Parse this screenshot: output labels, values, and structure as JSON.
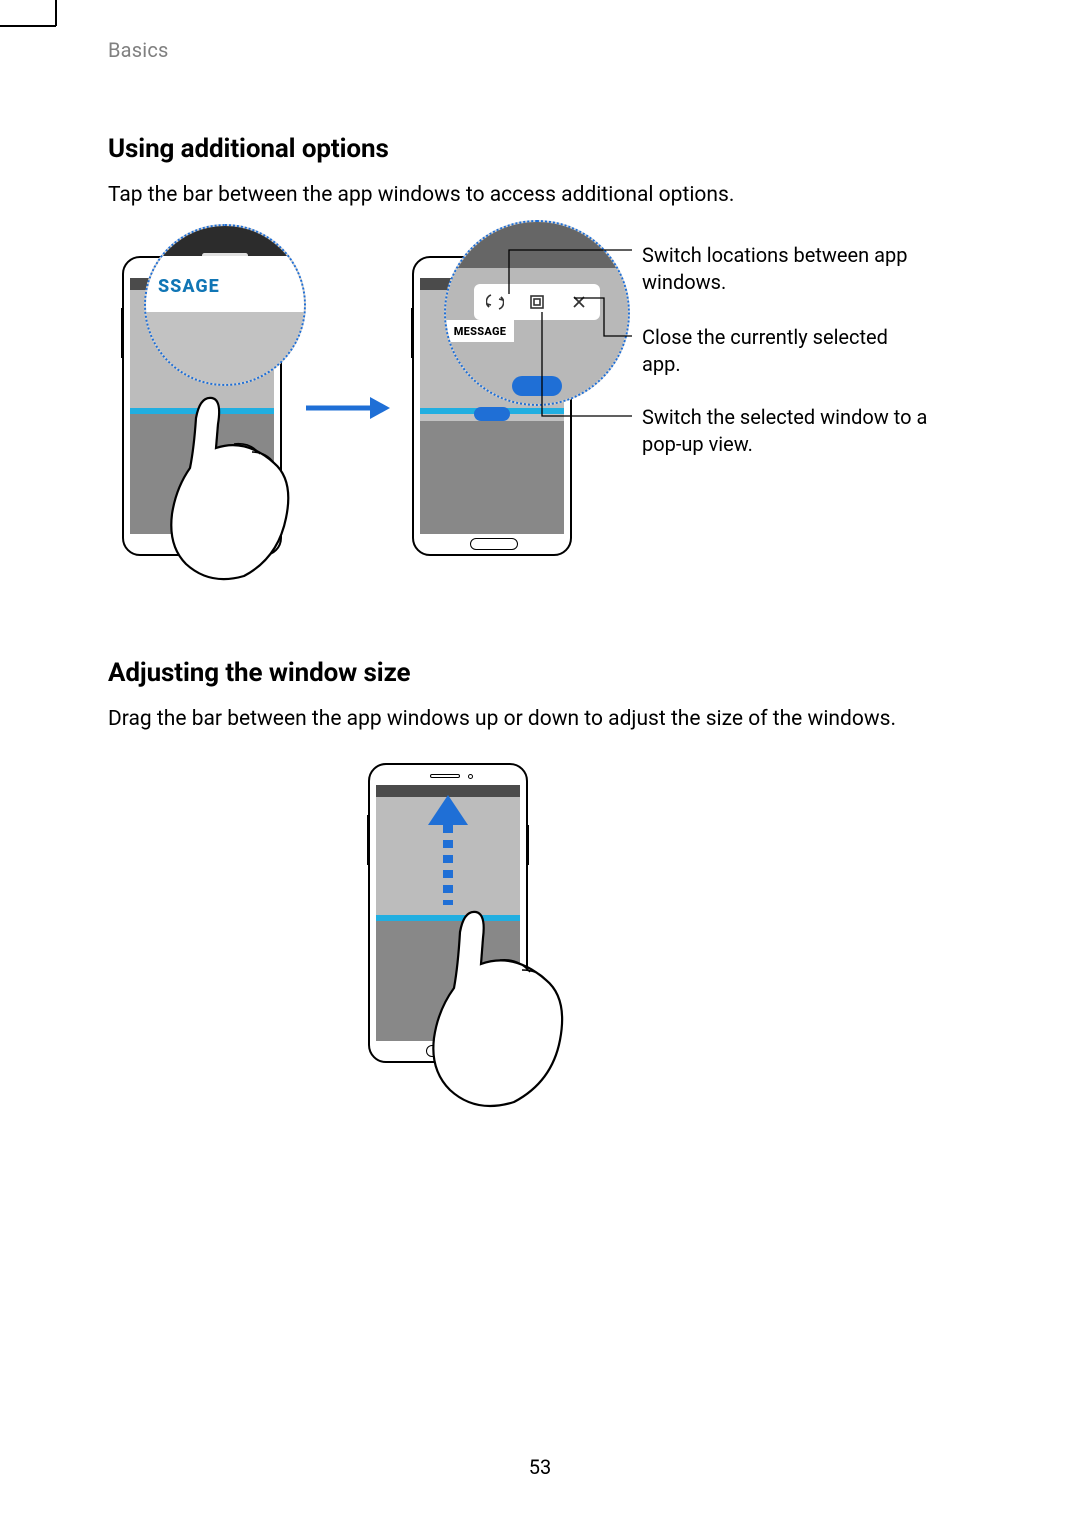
{
  "header": {
    "section": "Basics"
  },
  "section1": {
    "heading": "Using additional options",
    "body": "Tap the bar between the app windows to access additional options.",
    "mag1_label": "SSAGE",
    "mag2_tab": "MESSAGE",
    "callouts": {
      "switch_locations": "Switch locations between app windows.",
      "close_app": "Close the currently selected app.",
      "popup_view": "Switch the selected window to a pop-up view."
    },
    "icons": {
      "swap": "swap-icon",
      "popup": "popup-icon",
      "close": "close-icon"
    }
  },
  "section2": {
    "heading": "Adjusting the window size",
    "body": "Drag the bar between the app windows up or down to adjust the size of the windows."
  },
  "page_number": "53"
}
